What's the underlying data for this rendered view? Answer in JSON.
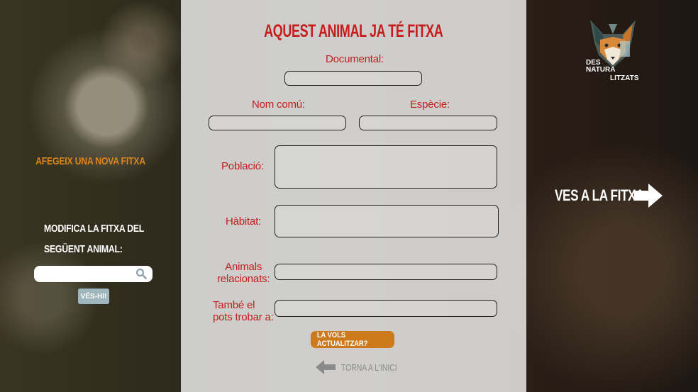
{
  "left_panel": {
    "new_card_link": "AFEGEIX UNA NOVA FITXA",
    "modify_line1": "MODIFICA LA FITXA DEL",
    "modify_line2": "SEGÜENT ANIMAL:",
    "search_value": "",
    "go_button": "VÉS-HI!"
  },
  "form": {
    "title": "AQUEST ANIMAL JA TÉ FITXA",
    "documental_label": "Documental:",
    "common_name_label": "Nom comú:",
    "species_label": "Espècie:",
    "population_label": "Població:",
    "habitat_label": "Hàbitat:",
    "related_label_1": "Animals",
    "related_label_2": "relacionats:",
    "also_label_1": "També el",
    "also_label_2": "pots trobar a:",
    "update_button": "LA VOLS ACTUALITZAR?",
    "back_link": "TORNA A L'INICI"
  },
  "right_panel": {
    "logo_line1": "DES",
    "logo_line2": "NATURA",
    "logo_line3": "LITZATS",
    "go_card": "VES A LA FITXA"
  },
  "colors": {
    "title_red": "#c71c1c",
    "accent_orange": "#cc7a1c",
    "go_button_blue": "#9fb6bd"
  },
  "icons": {
    "search": "search-icon",
    "back": "arrow-left-icon",
    "forward": "arrow-right-icon",
    "logo": "fox-logo-icon"
  }
}
